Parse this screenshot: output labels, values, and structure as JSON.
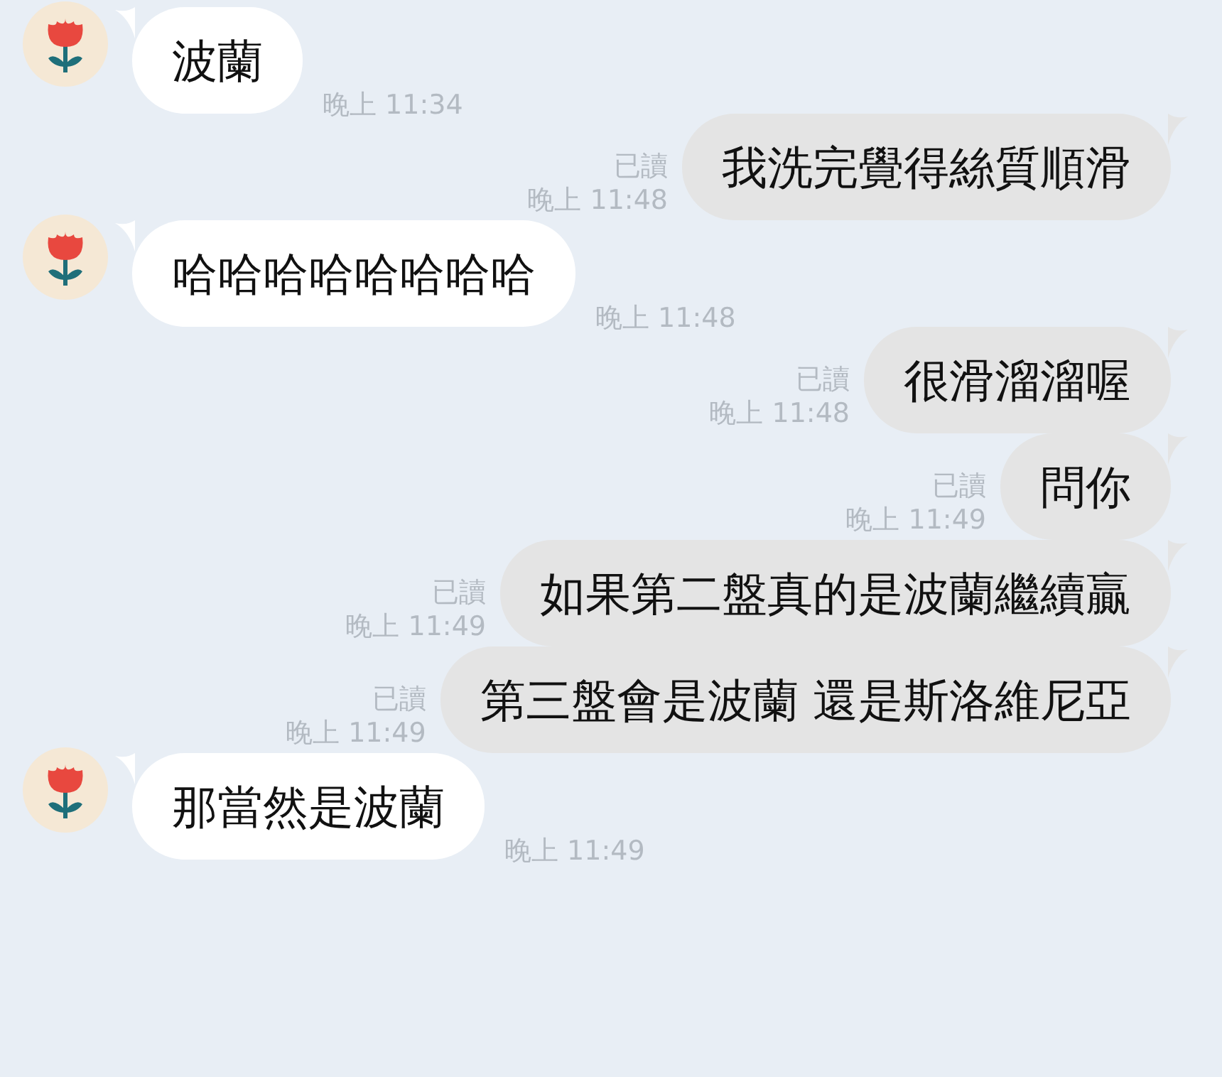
{
  "messages": [
    {
      "kind": "incoming",
      "text": "波蘭",
      "time": "晚上 11:34"
    },
    {
      "kind": "outgoing",
      "text": "我洗完覺得絲質順滑",
      "read": "已讀",
      "time": "晚上 11:48"
    },
    {
      "kind": "incoming",
      "text": "哈哈哈哈哈哈哈哈",
      "time": "晚上 11:48"
    },
    {
      "kind": "outgoing",
      "text": "很滑溜溜喔",
      "read": "已讀",
      "time": "晚上 11:48"
    },
    {
      "kind": "outgoing",
      "text": "問你",
      "read": "已讀",
      "time": "晚上 11:49"
    },
    {
      "kind": "outgoing",
      "text": "如果第二盤真的是波蘭繼續贏",
      "read": "已讀",
      "time": "晚上 11:49"
    },
    {
      "kind": "outgoing",
      "text": "第三盤會是波蘭 還是斯洛維尼亞",
      "read": "已讀",
      "time": "晚上 11:49"
    },
    {
      "kind": "incoming",
      "text": "那當然是波蘭",
      "time": "晚上 11:49"
    }
  ]
}
